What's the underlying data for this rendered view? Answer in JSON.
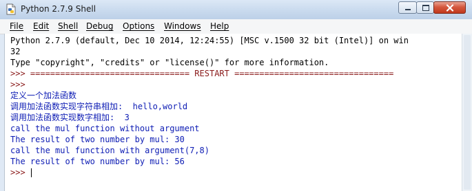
{
  "window": {
    "title": "Python 2.7.9 Shell",
    "icon": "python-idle-icon"
  },
  "menu": [
    {
      "label": "File"
    },
    {
      "label": "Edit"
    },
    {
      "label": "Shell"
    },
    {
      "label": "Debug"
    },
    {
      "label": "Options"
    },
    {
      "label": "Windows"
    },
    {
      "label": "Help"
    }
  ],
  "shell": {
    "lines": [
      {
        "text": "Python 2.7.9 (default, Dec 10 2014, 12:24:55) [MSC v.1500 32 bit (Intel)] on win",
        "kind": "banner"
      },
      {
        "text": "32",
        "kind": "banner"
      },
      {
        "text": "Type \"copyright\", \"credits\" or \"license()\" for more information.",
        "kind": "banner"
      },
      {
        "text": ">>> ================================ RESTART ================================",
        "kind": "restart"
      },
      {
        "text": ">>> ",
        "kind": "prompt"
      },
      {
        "text": "定义一个加法函数",
        "kind": "output"
      },
      {
        "text": "调用加法函数实现字符串相加:  hello,world",
        "kind": "output"
      },
      {
        "text": "调用加法函数实现数字相加:  3",
        "kind": "output"
      },
      {
        "text": "call the mul function without argument",
        "kind": "output"
      },
      {
        "text": "The result of two number by mul: 30",
        "kind": "output"
      },
      {
        "text": "call the mul function with argument(7,8)",
        "kind": "output"
      },
      {
        "text": "The result of two number by mul: 56",
        "kind": "output"
      },
      {
        "text": ">>> ",
        "kind": "prompt"
      }
    ]
  },
  "colors": {
    "output": "#0d1cb4",
    "prompt": "#8a1a1a",
    "banner": "#000000"
  }
}
